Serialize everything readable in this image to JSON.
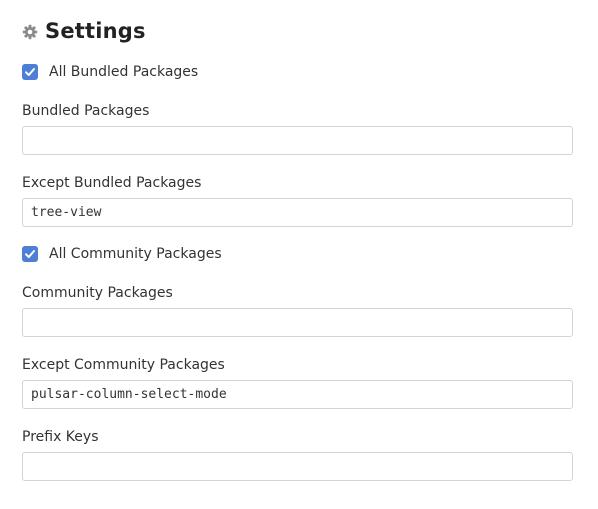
{
  "settings": {
    "title": "Settings",
    "header_icon": "gear-icon",
    "accent_color": "#4d7fd6",
    "all_bundled": {
      "label": "All Bundled Packages",
      "checked": true
    },
    "bundled_packages": {
      "label": "Bundled Packages",
      "value": ""
    },
    "except_bundled": {
      "label": "Except Bundled Packages",
      "value": "tree-view"
    },
    "all_community": {
      "label": "All Community Packages",
      "checked": true
    },
    "community_packages": {
      "label": "Community Packages",
      "value": ""
    },
    "except_community": {
      "label": "Except Community Packages",
      "value": "pulsar-column-select-mode"
    },
    "prefix_keys": {
      "label": "Prefix Keys",
      "value": ""
    }
  }
}
